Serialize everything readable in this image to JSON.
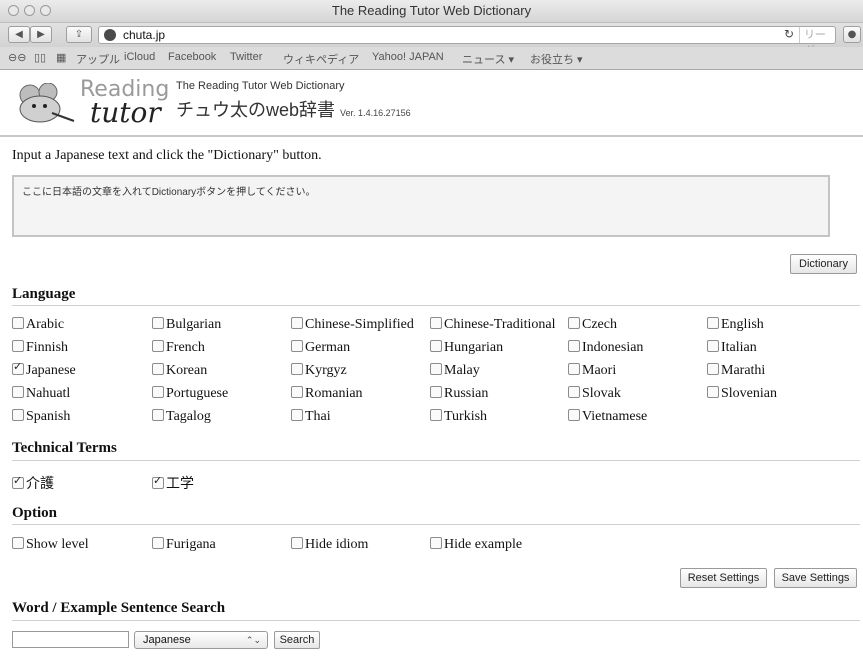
{
  "browser": {
    "window_title": "The Reading Tutor Web Dictionary",
    "url": "chuta.jp",
    "reader_label": "リーダー",
    "bookmarks": [
      "アップル",
      "iCloud",
      "Facebook",
      "Twitter",
      "ウィキペディア",
      "Yahoo! JAPAN",
      "ニュース ▾",
      "お役立ち ▾"
    ]
  },
  "header": {
    "logo_top": "Reading",
    "logo_bottom": "tutor",
    "site_name_en": "The Reading Tutor Web Dictionary",
    "site_name_jp": "チュウ太のweb辞書",
    "version": "Ver. 1.4.16.27156"
  },
  "input": {
    "instruction": "Input a Japanese text and click the \"Dictionary\" button.",
    "placeholder": "ここに日本語の文章を入れてDictionaryボタンを押してください。",
    "dictionary_button": "Dictionary"
  },
  "language": {
    "title": "Language",
    "options": [
      {
        "label": "Arabic",
        "checked": false
      },
      {
        "label": "Bulgarian",
        "checked": false
      },
      {
        "label": "Chinese-Simplified",
        "checked": false
      },
      {
        "label": "Chinese-Traditional",
        "checked": false
      },
      {
        "label": "Czech",
        "checked": false
      },
      {
        "label": "English",
        "checked": false
      },
      {
        "label": "Finnish",
        "checked": false
      },
      {
        "label": "French",
        "checked": false
      },
      {
        "label": "German",
        "checked": false
      },
      {
        "label": "Hungarian",
        "checked": false
      },
      {
        "label": "Indonesian",
        "checked": false
      },
      {
        "label": "Italian",
        "checked": false
      },
      {
        "label": "Japanese",
        "checked": true
      },
      {
        "label": "Korean",
        "checked": false
      },
      {
        "label": "Kyrgyz",
        "checked": false
      },
      {
        "label": "Malay",
        "checked": false
      },
      {
        "label": "Maori",
        "checked": false
      },
      {
        "label": "Marathi",
        "checked": false
      },
      {
        "label": "Nahuatl",
        "checked": false
      },
      {
        "label": "Portuguese",
        "checked": false
      },
      {
        "label": "Romanian",
        "checked": false
      },
      {
        "label": "Russian",
        "checked": false
      },
      {
        "label": "Slovak",
        "checked": false
      },
      {
        "label": "Slovenian",
        "checked": false
      },
      {
        "label": "Spanish",
        "checked": false
      },
      {
        "label": "Tagalog",
        "checked": false
      },
      {
        "label": "Thai",
        "checked": false
      },
      {
        "label": "Turkish",
        "checked": false
      },
      {
        "label": "Vietnamese",
        "checked": false
      }
    ]
  },
  "technical_terms": {
    "title": "Technical Terms",
    "options": [
      {
        "label": "介護",
        "checked": true
      },
      {
        "label": "工学",
        "checked": true
      }
    ]
  },
  "option": {
    "title": "Option",
    "options": [
      {
        "label": "Show level",
        "checked": false
      },
      {
        "label": "Furigana",
        "checked": false
      },
      {
        "label": "Hide idiom",
        "checked": false
      },
      {
        "label": "Hide example",
        "checked": false
      }
    ],
    "reset_button": "Reset Settings",
    "save_button": "Save Settings"
  },
  "search": {
    "title": "Word / Example Sentence Search",
    "input_value": "",
    "select_value": "Japanese",
    "search_button": "Search"
  }
}
